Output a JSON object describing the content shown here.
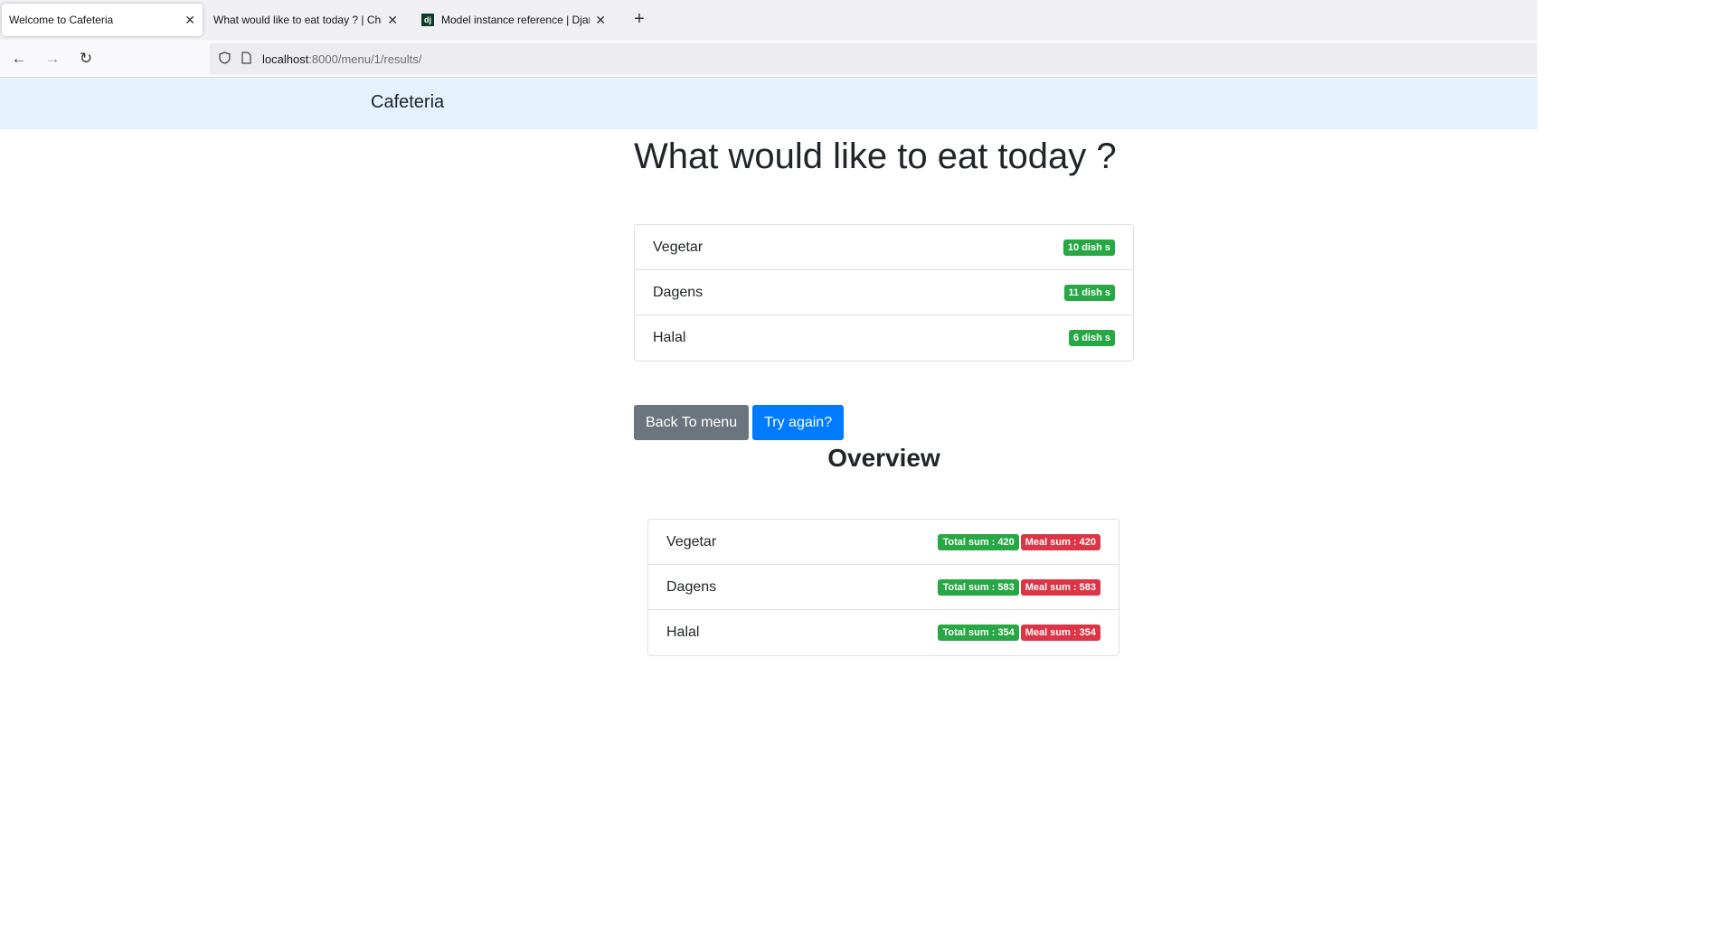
{
  "browser": {
    "tabs": [
      {
        "title": "Welcome to Cafeteria",
        "active": true
      },
      {
        "title": "What would like to eat today ? | Cha",
        "active": false
      },
      {
        "title": "Model instance reference | Djan",
        "active": false,
        "favicon": "dj"
      }
    ],
    "url_host": "localhost",
    "url_path": ":8000/menu/1/results/",
    "icons": {
      "back": "arrow-left-icon",
      "forward": "arrow-right-icon",
      "reload": "reload-icon",
      "shield": "shield-icon",
      "page": "page-icon",
      "new_tab": "plus-icon",
      "close": "close-icon"
    }
  },
  "site": {
    "brand": "Cafeteria"
  },
  "main": {
    "title": "What would like to eat today ?",
    "choices": [
      {
        "name": "Vegetar",
        "badge": "10 dish s"
      },
      {
        "name": "Dagens",
        "badge": "11 dish s"
      },
      {
        "name": "Halal",
        "badge": "6 dish s"
      }
    ],
    "back_button": "Back To menu",
    "retry_button": "Try again?",
    "overview_title": "Overview",
    "overview": [
      {
        "name": "Vegetar",
        "total": "Total sum : 420",
        "meal": "Meal sum : 420"
      },
      {
        "name": "Dagens",
        "total": "Total sum : 583",
        "meal": "Meal sum : 583"
      },
      {
        "name": "Halal",
        "total": "Total sum : 354",
        "meal": "Meal sum : 354"
      }
    ]
  },
  "colors": {
    "success": "#28a745",
    "danger": "#dc3545",
    "primary": "#007bff",
    "secondary": "#6c757d",
    "navbar": "#e3f2fd"
  }
}
